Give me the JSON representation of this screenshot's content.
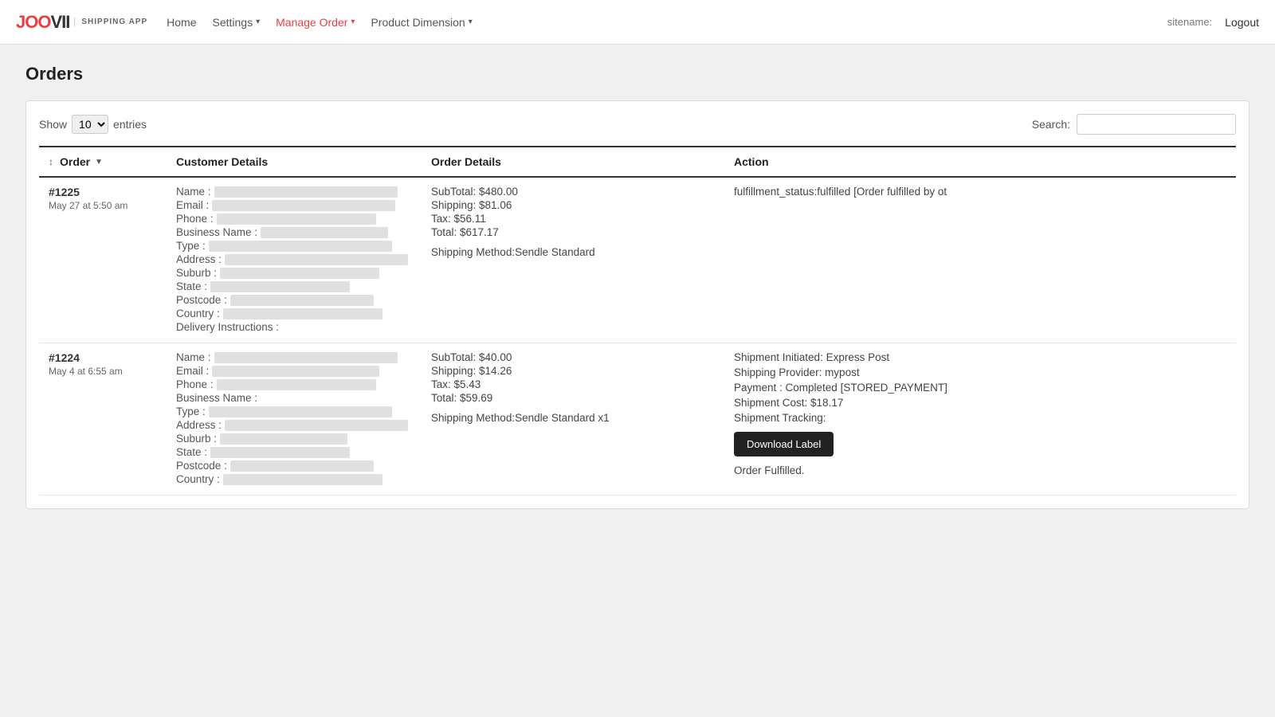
{
  "brand": {
    "logo": "JOOVII",
    "logo_color_part": "JOO",
    "sub": "SHIPPING APP"
  },
  "navbar": {
    "home_label": "Home",
    "settings_label": "Settings",
    "manage_order_label": "Manage Order",
    "product_dimension_label": "Product Dimension",
    "sitename_label": "sitename:",
    "logout_label": "Logout"
  },
  "page": {
    "title": "Orders"
  },
  "table": {
    "show_label": "Show",
    "entries_label": "entries",
    "search_label": "Search:",
    "show_value": "10",
    "columns": {
      "order": "Order",
      "customer_details": "Customer Details",
      "order_details": "Order Details",
      "action": "Action"
    },
    "rows": [
      {
        "id": "#1225",
        "date": "May 27 at 5:50 am",
        "customer": {
          "name_label": "Name :",
          "email_label": "Email :",
          "phone_label": "Phone :",
          "business_name_label": "Business Name :",
          "type_label": "Type :",
          "address_label": "Address :",
          "suburb_label": "Suburb :",
          "state_label": "State :",
          "postcode_label": "Postcode :",
          "country_label": "Country :",
          "delivery_label": "Delivery Instructions :",
          "name_w": 230,
          "email_w": 230,
          "phone_w": 200,
          "business_w": 160,
          "type_w": 230,
          "address_w": 230,
          "suburb_w": 200,
          "state_w": 175,
          "postcode_w": 180,
          "country_w": 200,
          "delivery_w": 0
        },
        "order_details": {
          "subtotal": "SubTotal: $480.00",
          "shipping": "Shipping: $81.06",
          "tax": "Tax: $56.11",
          "total": "Total: $617.17",
          "shipping_method": "Shipping Method:Sendle Standard"
        },
        "action": {
          "text": "fulfillment_status:fulfilled [Order fulfilled by ot",
          "has_download": false,
          "fulfilled": false
        }
      },
      {
        "id": "#1224",
        "date": "May 4 at 6:55 am",
        "customer": {
          "name_label": "Name :",
          "email_label": "Email :",
          "phone_label": "Phone :",
          "business_name_label": "Business Name :",
          "type_label": "Type :",
          "address_label": "Address :",
          "suburb_label": "Suburb :",
          "state_label": "State :",
          "postcode_label": "Postcode :",
          "country_label": "Country :",
          "name_w": 230,
          "email_w": 210,
          "phone_w": 200,
          "business_w": 0,
          "type_w": 230,
          "address_w": 230,
          "suburb_w": 160,
          "state_w": 175,
          "postcode_w": 180,
          "country_w": 200
        },
        "order_details": {
          "subtotal": "SubTotal: $40.00",
          "shipping": "Shipping: $14.26",
          "tax": "Tax: $5.43",
          "total": "Total: $59.69",
          "shipping_method": "Shipping Method:Sendle Standard x1"
        },
        "action": {
          "shipment_initiated": "Shipment Initiated: Express Post",
          "shipping_provider": "Shipping Provider: mypost",
          "payment": "Payment : Completed [STORED_PAYMENT]",
          "shipment_cost": "Shipment Cost: $18.17",
          "shipment_tracking": "Shipment Tracking:",
          "download_label": "Download Label",
          "has_download": true,
          "fulfilled_text": "Order Fulfilled.",
          "fulfilled": true
        }
      }
    ]
  }
}
